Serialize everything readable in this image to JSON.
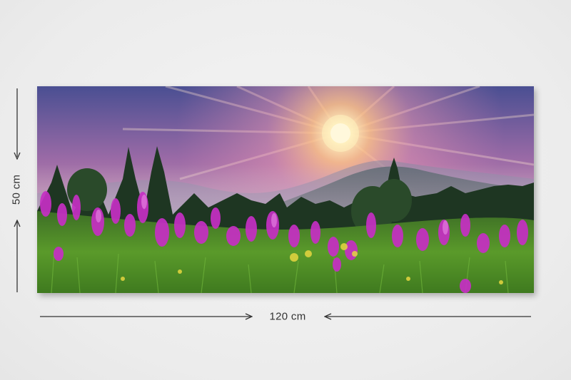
{
  "dimensions": {
    "height_label": "50 cm",
    "width_label": "120 cm"
  },
  "colors": {
    "background": "#ececec",
    "arrow": "#333333",
    "sky_top": "#4d5494",
    "sky_pink": "#d58aa8",
    "sun": "#fff6d0",
    "forest": "#1f3a24",
    "grass": "#4f8c24",
    "flowers": "#c02fc0"
  },
  "icons": {
    "top_arrow": "arrow-up-icon",
    "bottom_arrow": "arrow-down-icon",
    "left_arrow": "arrow-left-icon",
    "right_arrow": "arrow-right-icon"
  }
}
